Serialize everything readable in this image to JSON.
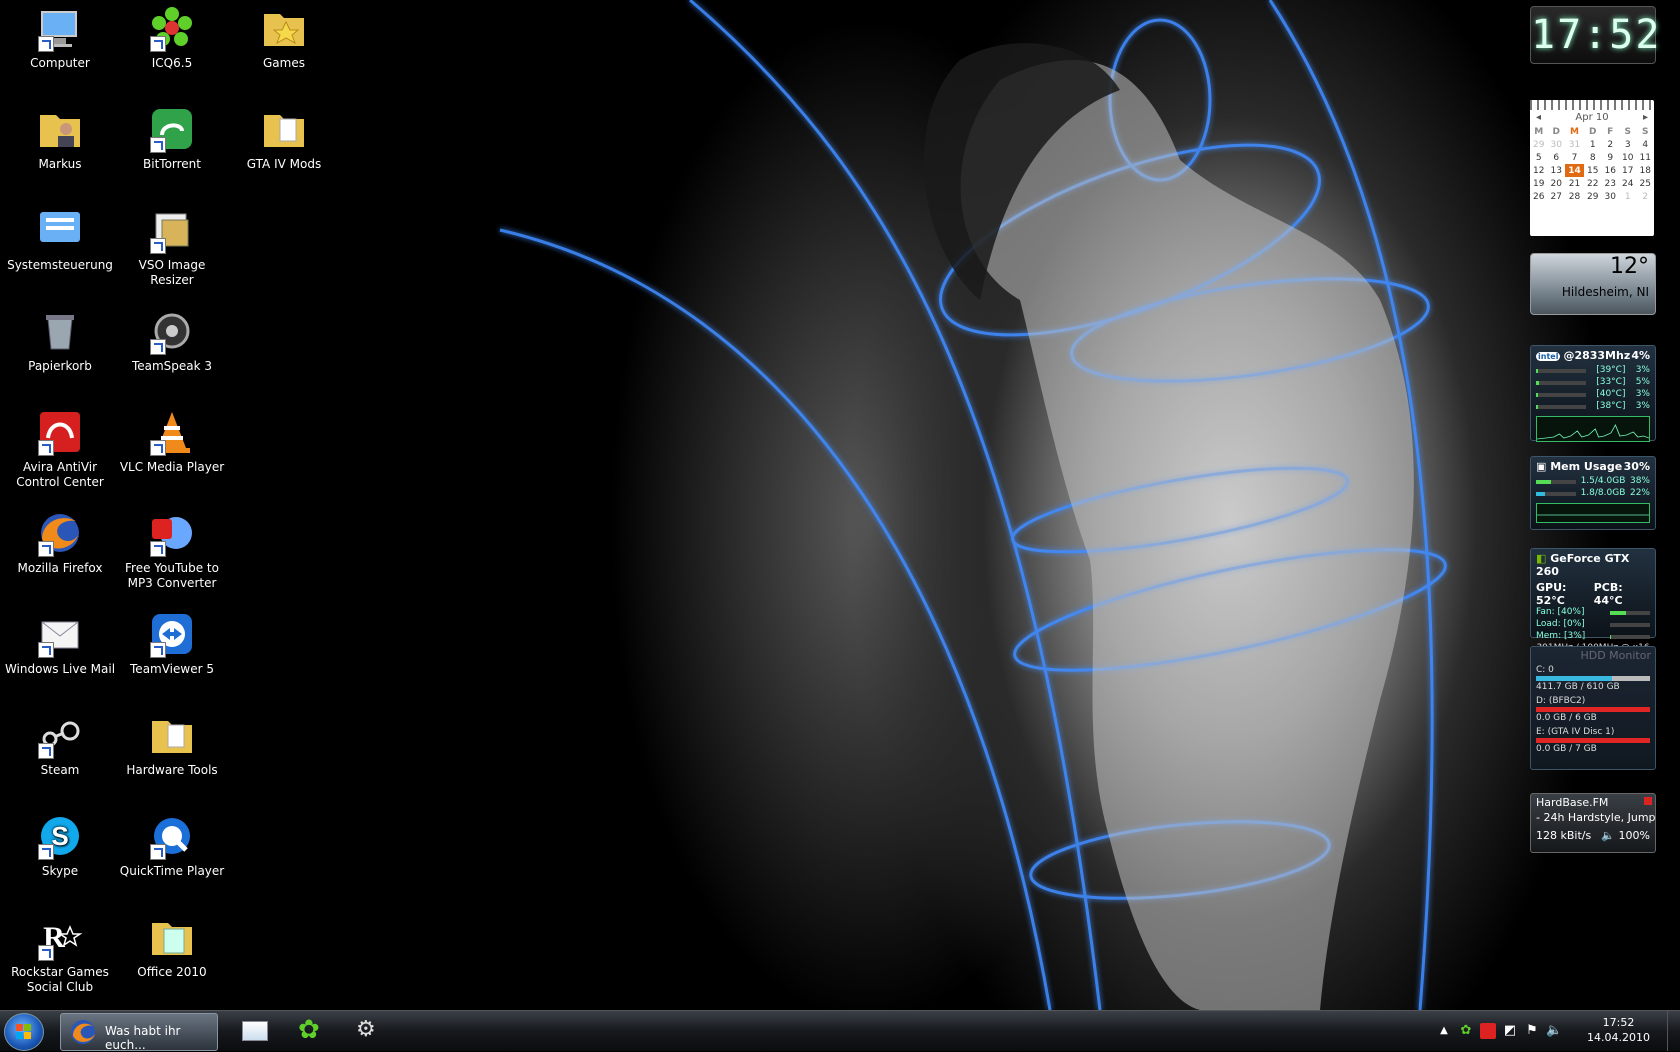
{
  "desktop": {
    "icons": [
      {
        "label": "Computer",
        "icon": "computer-icon"
      },
      {
        "label": "ICQ6.5",
        "icon": "icq-flower-icon"
      },
      {
        "label": "Games",
        "icon": "games-folder-icon"
      },
      {
        "label": "Markus",
        "icon": "user-folder-icon"
      },
      {
        "label": "BitTorrent",
        "icon": "bittorrent-icon"
      },
      {
        "label": "GTA IV Mods",
        "icon": "folder-icon"
      },
      {
        "label": "Systemsteuerung",
        "icon": "control-panel-icon"
      },
      {
        "label": "VSO Image Resizer",
        "icon": "image-resizer-icon"
      },
      {
        "label": "Papierkorb",
        "icon": "recycle-bin-icon"
      },
      {
        "label": "TeamSpeak 3",
        "icon": "teamspeak-icon"
      },
      {
        "label": "Avira AntiVir Control Center",
        "icon": "avira-umbrella-icon"
      },
      {
        "label": "VLC Media Player",
        "icon": "vlc-cone-icon"
      },
      {
        "label": "Mozilla Firefox",
        "icon": "firefox-icon"
      },
      {
        "label": "Free YouTube to MP3 Converter",
        "icon": "youtube-mp3-icon"
      },
      {
        "label": "Windows Live Mail",
        "icon": "live-mail-icon"
      },
      {
        "label": "TeamViewer 5",
        "icon": "teamviewer-icon"
      },
      {
        "label": "Steam",
        "icon": "steam-icon"
      },
      {
        "label": "Hardware Tools",
        "icon": "folder-icon"
      },
      {
        "label": "Skype",
        "icon": "skype-icon"
      },
      {
        "label": "QuickTime Player",
        "icon": "quicktime-icon"
      },
      {
        "label": "Rockstar Games Social Club",
        "icon": "rockstar-icon"
      },
      {
        "label": "Office 2010",
        "icon": "office-folder-icon"
      }
    ]
  },
  "gadgets": {
    "clock": {
      "time": "17:52"
    },
    "calendar": {
      "month": "Apr 10",
      "weekdays": [
        "M",
        "D",
        "M",
        "D",
        "F",
        "S",
        "S"
      ],
      "weeks": [
        [
          "29",
          "30",
          "31",
          "1",
          "2",
          "3",
          "4"
        ],
        [
          "5",
          "6",
          "7",
          "8",
          "9",
          "10",
          "11"
        ],
        [
          "12",
          "13",
          "14",
          "15",
          "16",
          "17",
          "18"
        ],
        [
          "19",
          "20",
          "21",
          "22",
          "23",
          "24",
          "25"
        ],
        [
          "26",
          "27",
          "28",
          "29",
          "30",
          "1",
          "2"
        ]
      ],
      "today": "14"
    },
    "weather": {
      "temp": "12°",
      "city": "Hildesheim, NI"
    },
    "cpu": {
      "title": "@2833Mhz",
      "total": "4%",
      "cores": [
        {
          "temp": "[39°C]",
          "load": "3%",
          "fill": 0.03
        },
        {
          "temp": "[33°C]",
          "load": "5%",
          "fill": 0.05
        },
        {
          "temp": "[40°C]",
          "load": "3%",
          "fill": 0.03
        },
        {
          "temp": "[38°C]",
          "load": "3%",
          "fill": 0.03
        }
      ]
    },
    "mem": {
      "title": "Mem Usage",
      "total": "30%",
      "rows": [
        {
          "text": "1.5/4.0GB",
          "pct": "38%",
          "fill": 0.38
        },
        {
          "text": "1.8/8.0GB",
          "pct": "22%",
          "fill": 0.22
        }
      ]
    },
    "gpu": {
      "title": "GeForce GTX 260",
      "gpu_temp": "GPU: 52°C",
      "pcb_temp": "PCB: 44°C",
      "fan": "Fan: [40%]",
      "load": "Load: [0%]",
      "memload": "Mem: [3%]",
      "clock": "301MHz / 100MHz @ x16",
      "fan_fill": 0.4,
      "load_fill": 0.0,
      "mem_fill": 0.03
    },
    "hdd": {
      "title": "HDD Monitor",
      "drives": [
        {
          "name": "C: 0",
          "size": "411.7 GB / 610 GB",
          "fill": 0.67,
          "color": "#39b8e0"
        },
        {
          "name": "D: (BFBC2)",
          "size": "0.0 GB / 6 GB",
          "fill": 1.0,
          "color": "#e02525"
        },
        {
          "name": "E: (GTA IV Disc 1)",
          "size": "0.0 GB / 7 GB",
          "fill": 1.0,
          "color": "#e02525"
        }
      ]
    },
    "radio": {
      "station": "HardBase.FM",
      "track": "- 24h Hardstyle, Jump",
      "bitrate": "128 kBit/s",
      "volume": "100%"
    }
  },
  "taskbar": {
    "active_window": "Was habt ihr euch...",
    "pinned": [
      "live-mail-icon",
      "icq-flower-icon",
      "steam-icon"
    ],
    "tray_time": "17:52",
    "tray_date": "14.04.2010"
  },
  "colors": {
    "accent_blue": "#3a7bff",
    "calendar_today": "#e06a12"
  }
}
